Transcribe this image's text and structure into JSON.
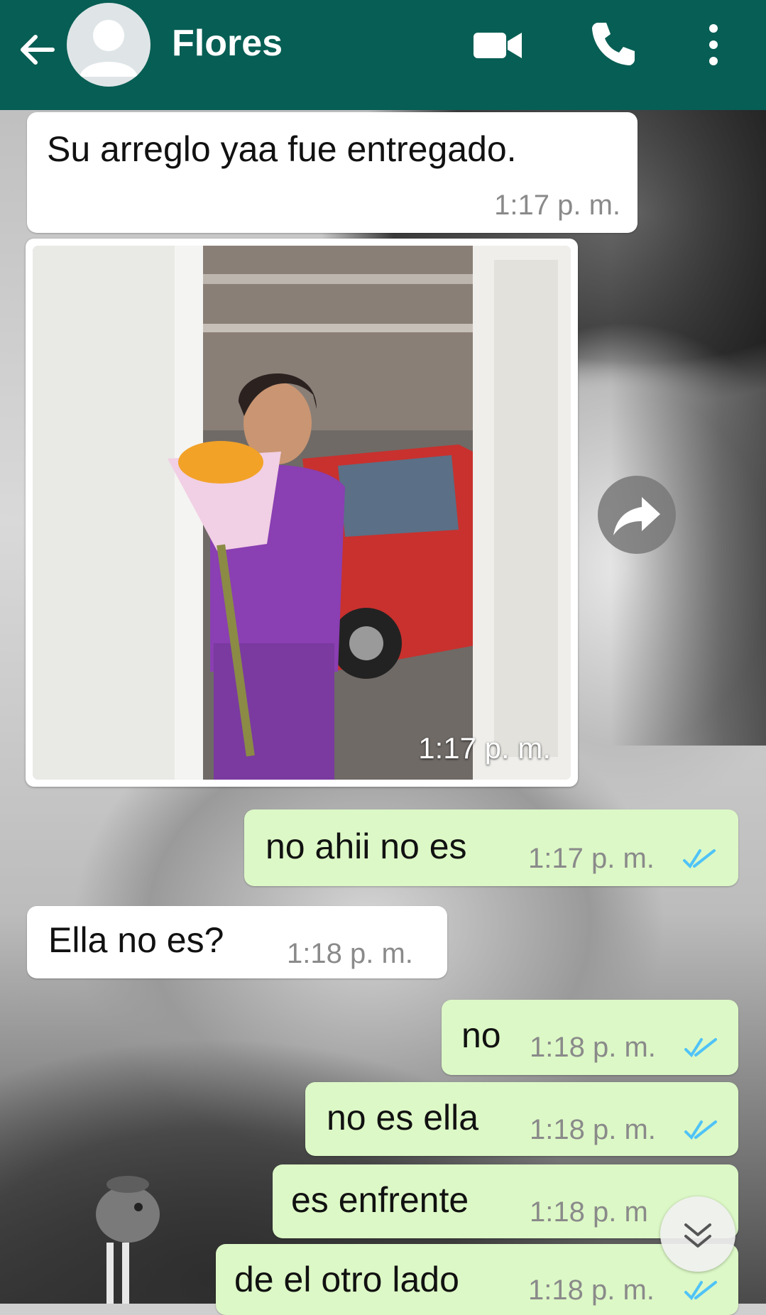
{
  "header": {
    "contact_name": "Flores",
    "back_icon": "arrow-left-icon",
    "video_icon": "video-camera-icon",
    "call_icon": "phone-icon",
    "menu_icon": "more-vertical-icon",
    "color": "#075e54"
  },
  "messages": [
    {
      "direction": "in",
      "text": "Su arreglo yaa fue entregado.",
      "time": "1:17 p. m."
    },
    {
      "direction": "in",
      "type": "image",
      "time": "1:17 p. m."
    },
    {
      "direction": "out",
      "text": "no ahii no es",
      "time": "1:17 p. m.",
      "status": "read"
    },
    {
      "direction": "in",
      "text": "Ella no es?",
      "time": "1:18 p. m."
    },
    {
      "direction": "out",
      "text": "no",
      "time": "1:18 p. m.",
      "status": "read"
    },
    {
      "direction": "out",
      "text": "no es ella",
      "time": "1:18 p. m.",
      "status": "read"
    },
    {
      "direction": "out",
      "text": "es enfrente",
      "time": "1:18 p. m",
      "status": "read"
    },
    {
      "direction": "out",
      "text": "de el otro lado",
      "time": "1:18 p. m.",
      "status": "read"
    }
  ],
  "controls": {
    "forward_icon": "forward-share-icon",
    "scroll_down_icon": "chevron-double-down-icon"
  },
  "colors": {
    "incoming_bubble": "#ffffff",
    "outgoing_bubble": "#dcf8c6",
    "read_ticks": "#4fc3f7"
  }
}
